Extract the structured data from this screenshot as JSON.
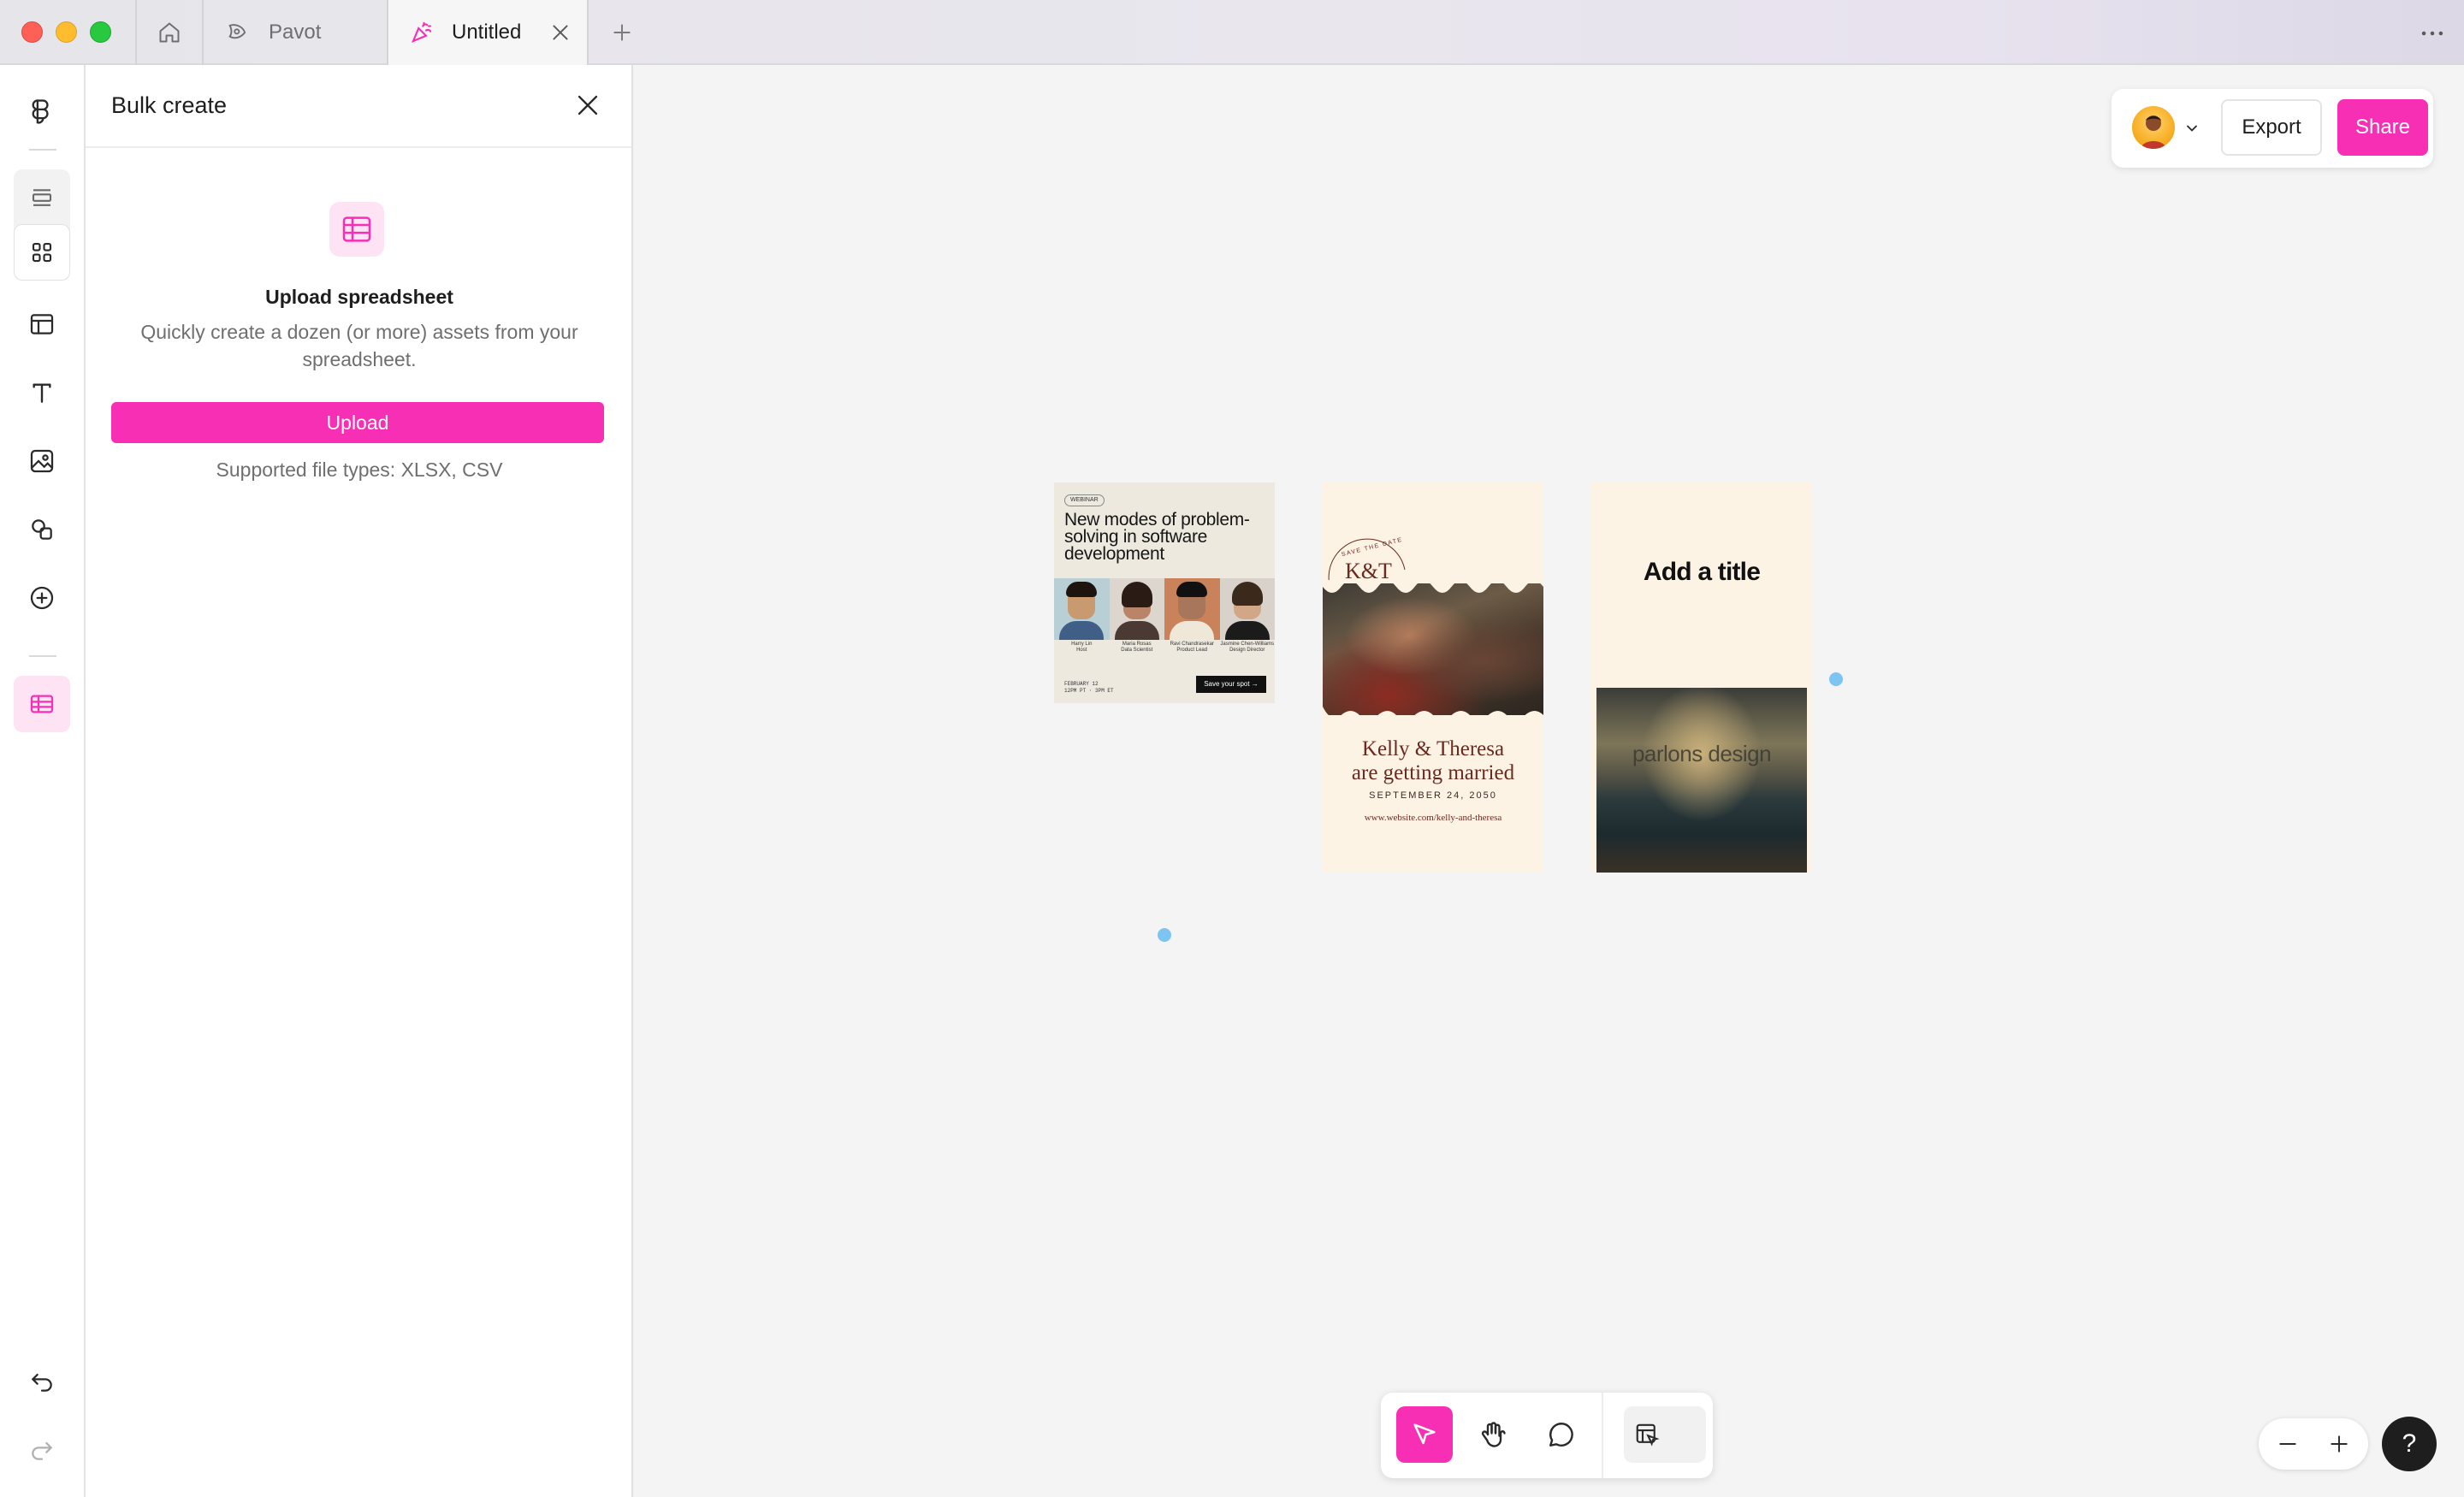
{
  "tabs": [
    {
      "label": "Pavot",
      "icon": "pavot-logo-icon"
    },
    {
      "label": "Untitled",
      "icon": "party-popper-icon"
    }
  ],
  "panel": {
    "title": "Bulk create",
    "upload_title": "Upload spreadsheet",
    "upload_description": "Quickly create a dozen (or more) assets from your spreadsheet.",
    "upload_button": "Upload",
    "supported_types": "Supported file types: XLSX, CSV"
  },
  "header": {
    "export_label": "Export",
    "share_label": "Share"
  },
  "canvas": {
    "card1": {
      "tag": "WEBINAR",
      "headline": "New modes of problem-solving in software development",
      "people": [
        {
          "name": "Harry Lin",
          "role": "Host"
        },
        {
          "name": "Maria Rosas",
          "role": "Data Scientist"
        },
        {
          "name": "Ravi Chandrasekar",
          "role": "Product Lead"
        },
        {
          "name": "Jasmine Chen-Williams",
          "role": "Design Director"
        }
      ],
      "footer_date": "FEBRUARY 12",
      "footer_time": "12PM PT  ·  3PM ET",
      "cta": "Save your spot →"
    },
    "card2": {
      "badge_top": "SAVE THE DATE",
      "monogram": "K&T",
      "names_line1": "Kelly & Theresa",
      "names_line2": "are getting married",
      "date": "SEPTEMBER 24, 2050",
      "url": "www.website.com/kelly-and-theresa"
    },
    "card3": {
      "title": "Add a title",
      "photo_text": "parlons design"
    }
  },
  "colors": {
    "accent": "#f72fb5",
    "accent_soft": "#fde3f3",
    "selection_handle": "#7cc4f2"
  }
}
